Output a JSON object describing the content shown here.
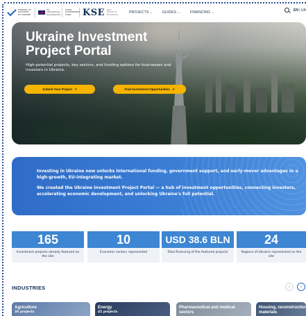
{
  "header": {
    "logos": {
      "mfa_text": "MINISTRY OF ECONOMY OF UKRAINE",
      "uk_text": "UK International Development",
      "good_text": "GOOD GOVERNANCE FUND",
      "kse_text": "KSE",
      "kse_sub": "Kyiv School of Economics"
    },
    "nav": [
      {
        "label": "PROJECTS"
      },
      {
        "label": "GUIDES"
      },
      {
        "label": "FINANCING"
      }
    ],
    "lang_en": "EN",
    "lang_sep": " | ",
    "lang_ua": "UA"
  },
  "hero": {
    "title": "Ukraine Investment Project Portal",
    "subtitle": "High-potential projects, key sectors, and funding options for businesses and investors in Ukraine.",
    "submit_label": "Submit Your Project",
    "find_label": "Find Investment Opportunities",
    "arrow": "↗"
  },
  "banner": {
    "p1": "Investing in Ukraine now unlocks international funding, government support, and early-mover advantages in a high-growth, EU-integrating market.",
    "p2": "We created the Ukraine Investment Project Portal — a hub of investment opportunities, connecting investors, accelerating economic development, and unlocking Ukraine's full potential."
  },
  "stats": [
    {
      "value": "165",
      "caption": "Investment projects already featured on the site"
    },
    {
      "value": "10",
      "caption": "Economic sectors represented"
    },
    {
      "value": "USD 38.6 BLN",
      "caption": "Total financing of the featured projects"
    },
    {
      "value": "24",
      "caption": "Regions of Ukraine represented on the site"
    }
  ],
  "industries": {
    "title": "INDUSTRIES",
    "prev": "‹",
    "next": "›",
    "cards": [
      {
        "title": "Agriculture",
        "sub": "26 projects"
      },
      {
        "title": "Energy",
        "sub": "41 projects"
      },
      {
        "title": "Pharmaceutical and medical sectors",
        "sub": ""
      },
      {
        "title": "Housing, reconstruction and building materials",
        "sub": ""
      }
    ]
  },
  "colors": {
    "accent_yellow": "#f5b400",
    "stat_blue": "#3d86d3",
    "banner_blue": "#3c80d6",
    "navy": "#0f2a55"
  }
}
